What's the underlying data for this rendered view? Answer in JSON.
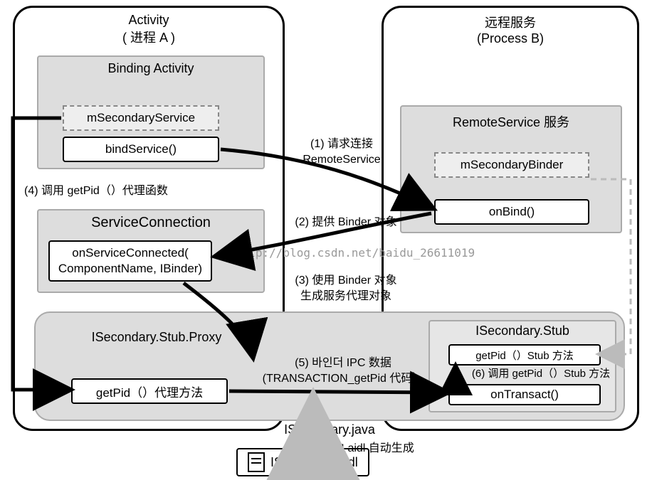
{
  "processA": {
    "title_line1": "Activity",
    "title_line2": "( 进程 A )"
  },
  "processB": {
    "title_line1": "远程服务",
    "title_line2": "(Process B)"
  },
  "bindingActivity": {
    "title": "Binding Activity",
    "field": "mSecondaryService",
    "method": "bindService()"
  },
  "remoteService": {
    "title": "RemoteService 服务",
    "field": "mSecondaryBinder",
    "method": "onBind()"
  },
  "serviceConnection": {
    "title": "ServiceConnection",
    "callback_line1": "onServiceConnected(",
    "callback_line2": "ComponentName, IBinder)"
  },
  "proxy": {
    "title": "ISecondary.Stub.Proxy",
    "method": "getPid（）代理方法"
  },
  "stub": {
    "title": "ISecondary.Stub",
    "method1": "getPid（）Stub 方法",
    "method2": "onTransact()"
  },
  "javaFile": {
    "label": "ISecondary.java"
  },
  "aidlFile": {
    "label": "ISecondary.aidl"
  },
  "aidlNote": {
    "text": "由 aidl 自动生成"
  },
  "edges": {
    "e1_line1": "(1) 请求连接",
    "e1_line2": "RemoteService",
    "e2": "(2) 提供 Binder 对象",
    "e3_line1": "(3) 使用 Binder 对象",
    "e3_line2": "生成服务代理对象",
    "e4": "(4) 调用 getPid（）代理函数",
    "e5_line1": "(5) 바인더 IPC 数据",
    "e5_line2": "(TRANSACTION_getPid 代码）",
    "e6": "(6) 调用 getPid（）Stub 方法"
  },
  "watermark": "http://blog.csdn.net/baidu_26611019"
}
